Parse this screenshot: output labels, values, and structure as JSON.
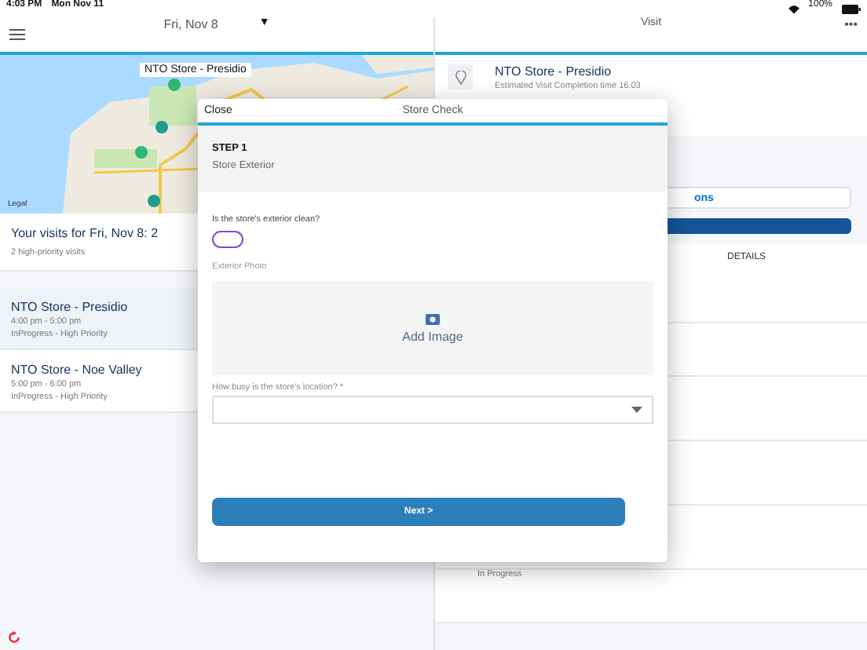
{
  "status_bar": {
    "time": "4:03 PM",
    "date": "Mon Nov 11",
    "battery": "100%"
  },
  "left_header": {
    "date": "Fri, Nov 8",
    "caret": "▼"
  },
  "map": {
    "callout": "NTO Store - Presidio",
    "legal": "Legal"
  },
  "visits": {
    "title": "Your visits for Fri, Nov 8: 2",
    "subtitle": "2 high-priority visits",
    "items": [
      {
        "name": "NTO Store - Presidio",
        "time": "4:00 pm - 5:00 pm",
        "status": "InProgress - High Priority",
        "selected": true
      },
      {
        "name": "NTO Store - Noe Valley",
        "time": "5:00 pm - 6:00 pm",
        "status": "InProgress - High Priority",
        "selected": false
      }
    ]
  },
  "right_header": {
    "title": "Visit",
    "more": "•••"
  },
  "visit": {
    "name": "NTO Store - Presidio",
    "estimate": "Estimated Visit Completion time 16:03"
  },
  "actions_button": "ons",
  "details_tab": "DETAILS",
  "status_text": "In Progress",
  "modal": {
    "close": "Close",
    "title": "Store Check",
    "step": "STEP 1",
    "step_name": "Store Exterior",
    "question": "Is the store's exterior clean?",
    "toggle_on": false,
    "photo_label": "Exterior Photo",
    "add_image": "Add Image",
    "select_label": "How busy is the store's location? *",
    "next": "Next >"
  }
}
